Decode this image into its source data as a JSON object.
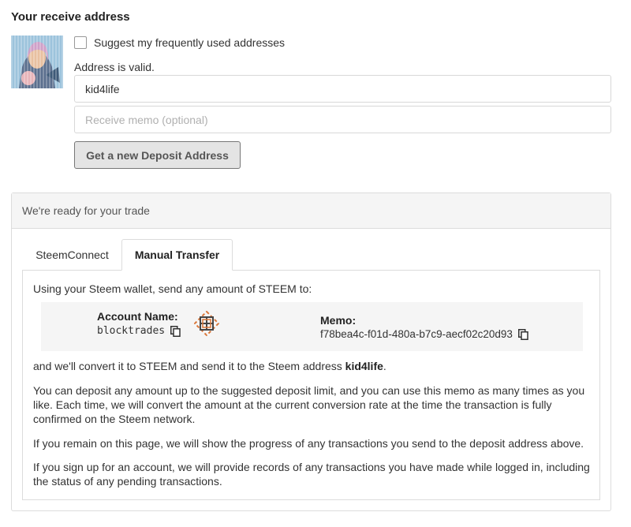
{
  "receive": {
    "title": "Your receive address",
    "suggest_label": "Suggest my frequently used addresses",
    "valid_text": "Address is valid.",
    "address_value": "kid4life",
    "memo_placeholder": "Receive memo (optional)",
    "deposit_button": "Get a new Deposit Address"
  },
  "panel": {
    "header": "We're ready for your trade",
    "tabs": [
      {
        "label": "SteemConnect",
        "active": false
      },
      {
        "label": "Manual Transfer",
        "active": true
      }
    ],
    "intro": "Using your Steem wallet, send any amount of STEEM to:",
    "account_label": "Account Name:",
    "account_value": "blocktrades",
    "memo_label": "Memo:",
    "memo_value": "f78bea4c-f01d-480a-b7c9-aecf02c20d93",
    "convert_prefix": "and we'll convert it to STEEM and send it to the Steem address ",
    "convert_address": "kid4life",
    "convert_suffix": ".",
    "para1": "You can deposit any amount up to the suggested deposit limit, and you can use this memo as many times as you like. Each time, we will convert the amount at the current conversion rate at the time the transaction is fully confirmed on the Steem network.",
    "para2": "If you remain on this page, we will show the progress of any transactions you send to the deposit address above.",
    "para3": "If you sign up for an account, we will provide records of any transactions you have made while logged in, including the status of any pending transactions."
  },
  "icons": {
    "copy": "copy-icon",
    "checkbox": "checkbox-icon",
    "logo": "blocktrades-logo"
  },
  "colors": {
    "logo_orange": "#d9773a",
    "logo_dark": "#444444",
    "panel_bg": "#f5f5f5"
  }
}
